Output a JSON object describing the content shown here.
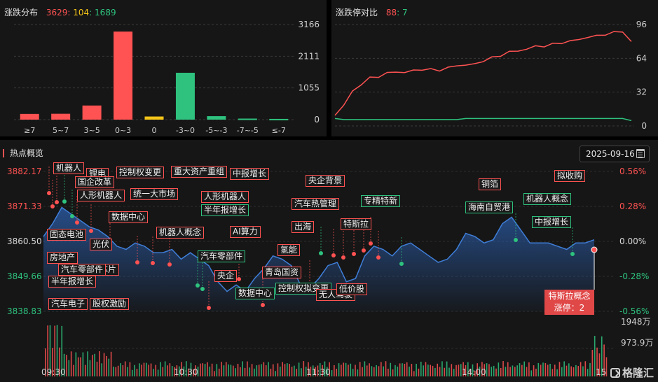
{
  "dist": {
    "title": "涨跌分布",
    "up": "3629",
    "flat": "104",
    "down": "1689",
    "sep1": ":",
    "sep2": ":"
  },
  "ratio": {
    "title": "涨跌停对比",
    "limit_up": "88",
    "sep": ":",
    "limit_down": "7"
  },
  "hot": {
    "title": "热点概览",
    "date": "2025-09-16",
    "tooltip_line1": "特斯拉概念",
    "tooltip_line2": "涨停：2",
    "logo": "格隆汇"
  },
  "hot_axes": {
    "price_ticks": [
      "3882.17",
      "3871.33",
      "3860.50",
      "3849.66",
      "3838.83"
    ],
    "pct_ticks": [
      "0.56%",
      "0.28%",
      "0.00%",
      "-0.28%",
      "-0.56%"
    ],
    "vol_ticks": [
      "1948万",
      "973.9万"
    ],
    "time_ticks": [
      "09:30",
      "10:30",
      "11:30",
      "14:00",
      "15:00"
    ]
  },
  "hot_labels": [
    "机器人",
    "锂电",
    "国企改革",
    "人形机器人",
    "控制权变更",
    "重大资产重组",
    "中报增长",
    "统一大市场",
    "数据中心",
    "固态电池",
    "光伏",
    "机器人概念",
    "人形机器人",
    "半年报增长",
    "AI算力",
    "央企背景",
    "汽车热管理",
    "专精特新",
    "铜箔",
    "海南自贸港",
    "机器人概念",
    "中报增长",
    "拟收购",
    "房地产",
    "汽车零部件",
    "存储芯片",
    "半年报增长",
    "汽车零部件",
    "央企",
    "数据中心",
    "出海",
    "特斯拉",
    "氢能",
    "青岛国资",
    "控制权拟变更",
    "无人驾驶",
    "低价股",
    "汽车电子",
    "股权激励"
  ],
  "colors": {
    "up": "#ff5252",
    "down": "#2ec27e",
    "flat": "#f5c518",
    "line": "#3f7ed8",
    "bg": "#161616"
  },
  "chart_data": [
    {
      "type": "bar",
      "title": "涨跌分布",
      "categories": [
        "≥7",
        "5~7",
        "3~5",
        "0~3",
        "0",
        "-3~0",
        "-5~-3",
        "-7~-5",
        "≤-7"
      ],
      "values": [
        190,
        195,
        470,
        2930,
        104,
        1560,
        115,
        35,
        25
      ],
      "ylim": [
        0,
        3166
      ],
      "yticks": [
        "3166",
        "2111",
        "1055",
        "0"
      ]
    },
    {
      "type": "line",
      "title": "涨跌停对比",
      "yticks": [
        "96",
        "64",
        "32",
        "0"
      ],
      "ylim": [
        0,
        96
      ],
      "series": [
        {
          "name": "",
          "values": [
            10,
            20,
            32,
            40,
            45,
            47,
            50,
            51,
            51,
            52,
            54,
            53,
            53,
            55,
            57,
            58,
            58,
            62,
            64,
            67,
            70,
            71,
            73,
            75,
            76,
            77,
            79,
            80,
            82,
            84,
            85,
            87,
            88,
            90,
            79
          ]
        },
        {
          "name": "",
          "values": [
            7,
            6,
            6,
            6,
            6,
            6,
            6,
            6,
            6,
            6,
            6,
            6,
            6,
            6,
            6,
            7,
            7,
            7,
            7,
            7,
            7,
            7,
            7,
            7,
            7,
            7,
            7,
            7,
            7,
            7,
            7,
            7,
            7,
            7,
            5
          ]
        }
      ]
    },
    {
      "type": "area",
      "title": "热点概览",
      "ylim": [
        3838.83,
        3882.17
      ],
      "yticks": [
        "3882.17",
        "3871.33",
        "3860.50",
        "3849.66",
        "3838.83"
      ],
      "xticks": [
        "09:30",
        "10:30",
        "11:30",
        "14:00",
        "15:00"
      ],
      "series": [
        {
          "name": "",
          "values": [
            3862,
            3866,
            3871,
            3869,
            3867,
            3865,
            3864,
            3862,
            3859,
            3858,
            3860,
            3859,
            3857,
            3857,
            3858,
            3855,
            3857,
            3855,
            3853,
            3848,
            3845,
            3847,
            3845,
            3849,
            3852,
            3856,
            3855,
            3853,
            3847,
            3846,
            3849,
            3853,
            3854,
            3848,
            3849,
            3856,
            3859,
            3858,
            3856,
            3859,
            3860,
            3858,
            3856,
            3854,
            3855,
            3858,
            3863,
            3862,
            3860,
            3861,
            3866,
            3868,
            3864,
            3860,
            3860,
            3860,
            3859,
            3858,
            3860,
            3860,
            3861
          ]
        }
      ]
    }
  ]
}
